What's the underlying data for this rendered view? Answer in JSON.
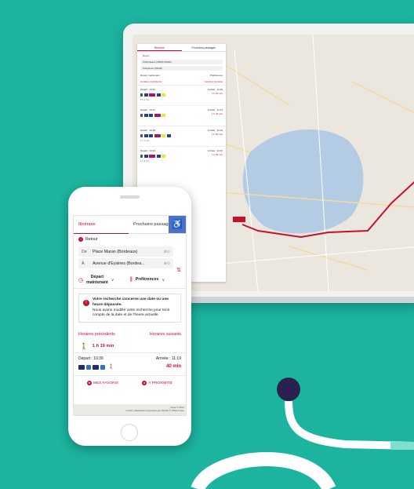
{
  "colors": {
    "background": "#1cb49f",
    "accent": "#c8102e",
    "decor_dot": "#2a2150",
    "accessibility": "#4a73c6"
  },
  "laptop": {
    "tabs": [
      "Itinéraire",
      "Prochains passages"
    ],
    "retour": "Retour",
    "from": "Pl.Bordeaux (33000 33049)",
    "to": "Pl.Eysines (33320)",
    "depart": "Départ maintenant",
    "preferences": "Préférences",
    "horaires_prev": "Horaires précédents",
    "horaires_next": "Horaires suivants",
    "results": [
      {
        "depart": "Départ : 10:31",
        "arrivee": "Arrivée : 11:29",
        "duree": "1 h 00 min",
        "walk": "1 h 4 min"
      },
      {
        "depart": "Départ : 10:37",
        "arrivee": "Arrivée : 11:24",
        "duree": "1 h 46 min",
        "walk": ""
      },
      {
        "depart": "Départ : 10:38",
        "arrivee": "Arrivée : 11:29",
        "duree": "1 h 50 min",
        "walk": "1 h 4 min"
      },
      {
        "depart": "Départ : 10:40",
        "arrivee": "Arrivée : 11:31",
        "duree": "1 h 46 min",
        "walk": "1 h 4 min"
      }
    ]
  },
  "phone": {
    "tabs": {
      "itineraire": "Itinéraire",
      "prochains": "Prochains passages"
    },
    "accessibility_icon": "wheelchair-icon",
    "retour": "Retour",
    "from": {
      "label": "De",
      "value": "Place Maran (Bordeaux)"
    },
    "to": {
      "label": "À",
      "value": "Avenue d'Eysines (Bordea..."
    },
    "depart": {
      "line1": "Départ",
      "line2": "maintenant"
    },
    "preferences": "Préférences",
    "alert": {
      "title": "Votre recherche concerne une date ou une heure dépassée.",
      "body": "Nous avons modifié votre recherche pour tenir compte de la date et de l'heure actuelle."
    },
    "horaires_prev": "Horaires précédents",
    "horaires_next": "Horaires suivants",
    "walk_duration": "1 h 19 min",
    "result": {
      "depart": "Départ : 10:39",
      "arrivee": "Arrivée : 11:19",
      "duree": "40 min"
    },
    "actions": {
      "favoris": "MES FAVORIS",
      "proximite": "À PROXIMITÉ"
    },
    "attribution": {
      "map_text": "Carte © 2017",
      "leaflet": "Leaflet",
      "credits": "| Réalisation proposée par Navitia © OSM & Geo"
    }
  }
}
